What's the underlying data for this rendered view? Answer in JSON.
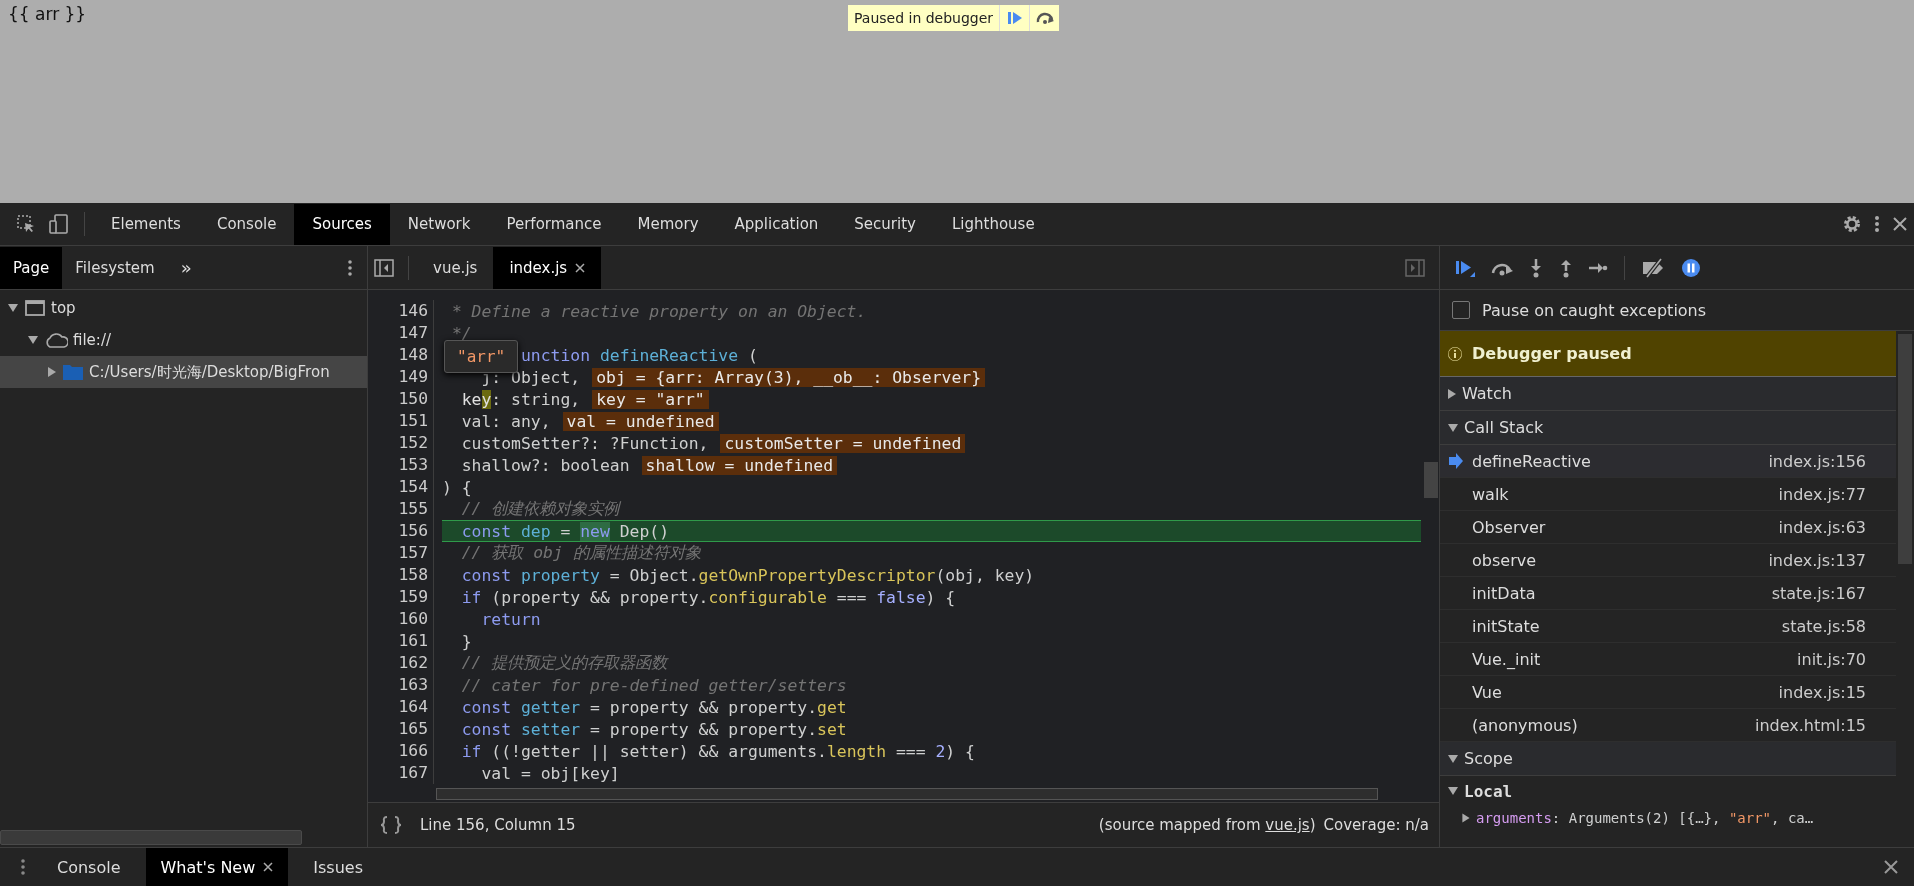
{
  "page": {
    "text": "{{ arr }}",
    "paused_overlay": {
      "label": "Paused in debugger"
    }
  },
  "toolbar": {
    "tabs": [
      {
        "label": "Elements",
        "selected": false
      },
      {
        "label": "Console",
        "selected": false
      },
      {
        "label": "Sources",
        "selected": true
      },
      {
        "label": "Network",
        "selected": false
      },
      {
        "label": "Performance",
        "selected": false
      },
      {
        "label": "Memory",
        "selected": false
      },
      {
        "label": "Application",
        "selected": false
      },
      {
        "label": "Security",
        "selected": false
      },
      {
        "label": "Lighthouse",
        "selected": false
      }
    ]
  },
  "navigator": {
    "tabs": [
      {
        "label": "Page",
        "selected": true
      },
      {
        "label": "Filesystem",
        "selected": false
      }
    ],
    "more": "»",
    "tree": [
      {
        "label": "top",
        "kind": "frame",
        "expanded": true,
        "selected": false,
        "children": [
          {
            "label": "file://",
            "kind": "origin",
            "expanded": true,
            "selected": false,
            "children": [
              {
                "label": "C:/Users/时光海/Desktop/BigFron",
                "kind": "folder",
                "expanded": false,
                "selected": true
              }
            ]
          }
        ]
      }
    ]
  },
  "editor": {
    "tabs": [
      {
        "label": "vue.js",
        "selected": false,
        "closable": false
      },
      {
        "label": "index.js",
        "selected": true,
        "closable": true
      }
    ],
    "tooltip": "\"arr\"",
    "lines": [
      {
        "number": "146",
        "current": false,
        "tokens": [
          {
            "t": " * Define a reactive property on an Object.",
            "kind": "comment"
          }
        ]
      },
      {
        "number": "147",
        "current": false,
        "tokens": [
          {
            "t": " */",
            "kind": "comment"
          }
        ]
      },
      {
        "number": "148",
        "current": false,
        "tokens": [
          {
            "t": "        unction ",
            "kind": "keyword"
          },
          {
            "t": "defineReactive",
            "kind": "definition"
          },
          {
            "t": " (",
            "kind": "plain"
          }
        ]
      },
      {
        "number": "149",
        "current": false,
        "tokens": [
          {
            "t": "    j: Object,",
            "kind": "plain"
          }
        ],
        "inline_value": "obj = {arr: Array(3), __ob__: Observer}"
      },
      {
        "number": "150",
        "current": false,
        "tokens": [
          {
            "t": "  key",
            "kind": "hover"
          },
          {
            "t": ": string,",
            "kind": "plain"
          }
        ],
        "inline_value": "key = \"arr\""
      },
      {
        "number": "151",
        "current": false,
        "tokens": [
          {
            "t": "  val: any,",
            "kind": "plain"
          }
        ],
        "inline_value": "val = undefined"
      },
      {
        "number": "152",
        "current": false,
        "tokens": [
          {
            "t": "  customSetter?: ?Function,",
            "kind": "plain"
          }
        ],
        "inline_value": "customSetter = undefined"
      },
      {
        "number": "153",
        "current": false,
        "tokens": [
          {
            "t": "  shallow?: boolean",
            "kind": "plain"
          }
        ],
        "inline_value": "shallow = undefined"
      },
      {
        "number": "154",
        "current": false,
        "tokens": [
          {
            "t": ") {",
            "kind": "plain"
          }
        ]
      },
      {
        "number": "155",
        "current": false,
        "tokens": [
          {
            "t": "  // 创建依赖对象实例",
            "kind": "comment"
          }
        ]
      },
      {
        "number": "156",
        "current": true,
        "tokens": [
          {
            "t": "  const ",
            "kind": "keyword"
          },
          {
            "t": "dep",
            "kind": "definition"
          },
          {
            "t": " = ",
            "kind": "plain"
          },
          {
            "t": "new",
            "kind": "hit"
          },
          {
            "t": " Dep()",
            "kind": "plain"
          }
        ]
      },
      {
        "number": "157",
        "current": false,
        "tokens": [
          {
            "t": "  // 获取 obj 的属性描述符对象",
            "kind": "comment"
          }
        ]
      },
      {
        "number": "158",
        "current": false,
        "tokens": [
          {
            "t": "  const ",
            "kind": "keyword"
          },
          {
            "t": "property",
            "kind": "definition"
          },
          {
            "t": " = Object.",
            "kind": "plain"
          },
          {
            "t": "getOwnPropertyDescriptor",
            "kind": "property"
          },
          {
            "t": "(obj, key)",
            "kind": "plain"
          }
        ]
      },
      {
        "number": "159",
        "current": false,
        "tokens": [
          {
            "t": "  if",
            "kind": "keyword"
          },
          {
            "t": " (property && property.",
            "kind": "plain"
          },
          {
            "t": "configurable",
            "kind": "property"
          },
          {
            "t": " === ",
            "kind": "plain"
          },
          {
            "t": "false",
            "kind": "atom"
          },
          {
            "t": ") {",
            "kind": "plain"
          }
        ]
      },
      {
        "number": "160",
        "current": false,
        "tokens": [
          {
            "t": "    return",
            "kind": "keyword"
          }
        ]
      },
      {
        "number": "161",
        "current": false,
        "tokens": [
          {
            "t": "  }",
            "kind": "plain"
          }
        ]
      },
      {
        "number": "162",
        "current": false,
        "tokens": [
          {
            "t": "  // 提供预定义的存取器函数",
            "kind": "comment"
          }
        ]
      },
      {
        "number": "163",
        "current": false,
        "tokens": [
          {
            "t": "  // cater for pre-defined getter/setters",
            "kind": "comment"
          }
        ]
      },
      {
        "number": "164",
        "current": false,
        "tokens": [
          {
            "t": "  const ",
            "kind": "keyword"
          },
          {
            "t": "getter",
            "kind": "definition"
          },
          {
            "t": " = property && property.",
            "kind": "plain"
          },
          {
            "t": "get",
            "kind": "property"
          }
        ]
      },
      {
        "number": "165",
        "current": false,
        "tokens": [
          {
            "t": "  const ",
            "kind": "keyword"
          },
          {
            "t": "setter",
            "kind": "definition"
          },
          {
            "t": " = property && property.",
            "kind": "plain"
          },
          {
            "t": "set",
            "kind": "property"
          }
        ]
      },
      {
        "number": "166",
        "current": false,
        "tokens": [
          {
            "t": "  if",
            "kind": "keyword"
          },
          {
            "t": " ((!getter || setter) && arguments.",
            "kind": "plain"
          },
          {
            "t": "length",
            "kind": "property"
          },
          {
            "t": " === ",
            "kind": "plain"
          },
          {
            "t": "2",
            "kind": "atom"
          },
          {
            "t": ") {",
            "kind": "plain"
          }
        ]
      },
      {
        "number": "167",
        "current": false,
        "tokens": [
          {
            "t": "    val = obj[key]",
            "kind": "plain"
          }
        ]
      }
    ]
  },
  "status_bar": {
    "position": "Line 156, Column 15",
    "source_prefix": "(source mapped from",
    "source_link": "vue.js",
    "source_suffix": ")",
    "coverage": "Coverage: n/a"
  },
  "debugger": {
    "pause_on_caught": {
      "label": "Pause on caught exceptions",
      "checked": false
    },
    "banner": "Debugger paused",
    "panes": [
      {
        "title": "Watch",
        "expanded": false
      },
      {
        "title": "Call Stack",
        "expanded": true,
        "frames": [
          {
            "name": "defineReactive",
            "location": "index.js:156",
            "selected": true
          },
          {
            "name": "walk",
            "location": "index.js:77",
            "selected": false
          },
          {
            "name": "Observer",
            "location": "index.js:63",
            "selected": false
          },
          {
            "name": "observe",
            "location": "index.js:137",
            "selected": false
          },
          {
            "name": "initData",
            "location": "state.js:167",
            "selected": false
          },
          {
            "name": "initState",
            "location": "state.js:58",
            "selected": false
          },
          {
            "name": "Vue._init",
            "location": "init.js:70",
            "selected": false
          },
          {
            "name": "Vue",
            "location": "index.js:15",
            "selected": false
          },
          {
            "name": "(anonymous)",
            "location": "index.html:15",
            "selected": false
          }
        ]
      },
      {
        "title": "Scope",
        "expanded": true,
        "scopes": [
          {
            "title": "Local",
            "expanded": true,
            "variables": [
              {
                "name": "arguments",
                "expanded": false,
                "value": [
                  {
                    "t": ": Arguments(2) [{…}, ",
                    "kind": "plain"
                  },
                  {
                    "t": "\"arr\"",
                    "kind": "string"
                  },
                  {
                    "t": ", ca…",
                    "kind": "plain"
                  }
                ]
              }
            ]
          }
        ]
      }
    ]
  },
  "drawer": {
    "tabs": [
      {
        "label": "Console",
        "selected": false,
        "closable": false
      },
      {
        "label": "What's New",
        "selected": true,
        "closable": true
      },
      {
        "label": "Issues",
        "selected": false,
        "closable": false
      }
    ]
  }
}
